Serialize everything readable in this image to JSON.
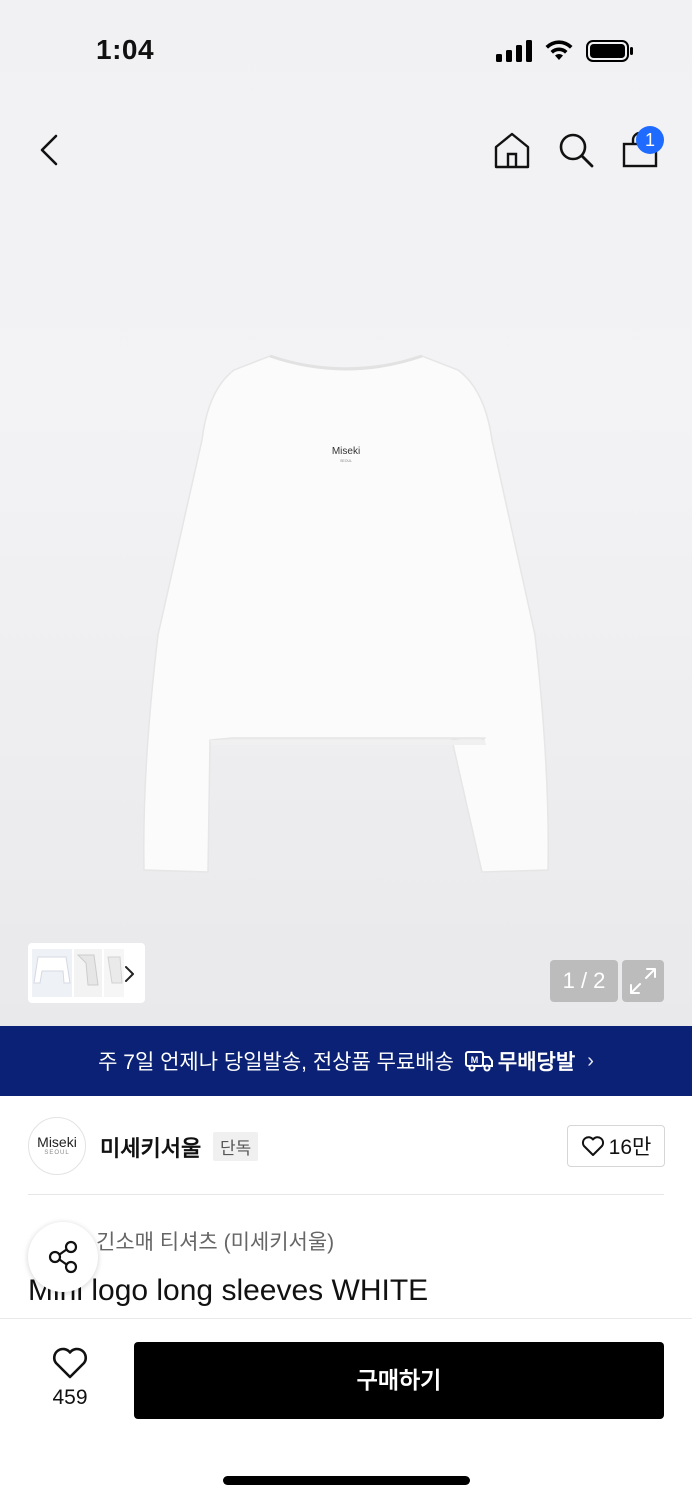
{
  "status_bar": {
    "time": "1:04"
  },
  "header": {
    "cart_count": "1"
  },
  "gallery": {
    "product_print_brand": "Miseki",
    "product_print_sub": "SEOUL",
    "page_counter": "1 / 2"
  },
  "promo_banner": {
    "text": "주 7일 언제나 당일발송, 전상품 무료배송",
    "tag_label": "무배당발"
  },
  "brand": {
    "logo_line1": "Miseki",
    "logo_line2": "SEOUL",
    "name": "미세키서울",
    "badge": "단독",
    "like_count": "16만"
  },
  "product": {
    "category": "긴소매 티셔츠 (미세키서울)",
    "title": "Mini logo long sleeves WHITE"
  },
  "bottom_bar": {
    "wish_count": "459",
    "buy_label": "구매하기"
  },
  "colors": {
    "promo_bg": "#0a2175",
    "badge_blue": "#1f6bff",
    "buy_button": "#000000"
  }
}
